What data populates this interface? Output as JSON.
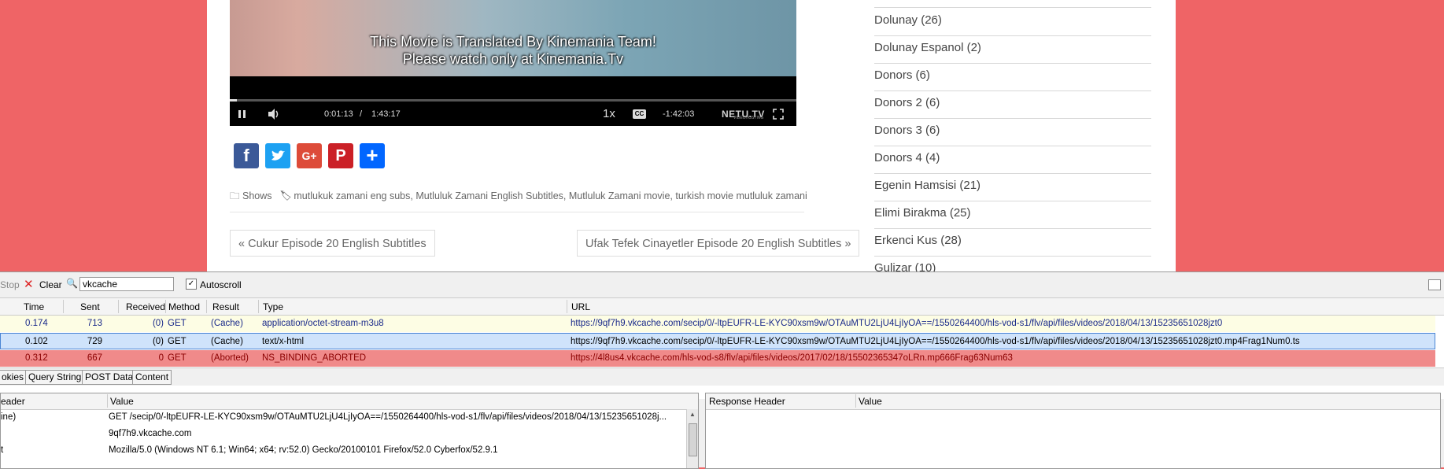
{
  "video": {
    "subtitle_line1": "This Movie is Translated By Kinemania Team!",
    "subtitle_line2": "Please watch only at Kinemania.Tv",
    "current_time": "0:01:13",
    "separator": "/",
    "duration": "1:43:17",
    "speed": "1x",
    "cc": "CC",
    "remaining": "-1:42:03",
    "logo": "NETU.TV",
    "logo_sub": "VIDEOHOSTING",
    "progress_fraction": 0.012
  },
  "share": {
    "facebook": "f",
    "google_plus": "G+",
    "pinterest": "P",
    "add": "+"
  },
  "meta": {
    "category": "Shows",
    "tags": [
      "mutlukuk zamani eng subs",
      "Mutluluk Zamani English Subtitles",
      "Mutluluk Zamani movie",
      "turkish movie mutluluk zamani"
    ]
  },
  "post_nav": {
    "prev": "« Cukur Episode 20 English Subtitles",
    "next": "Ufak Tefek Cinayetler Episode 20 English Subtitles »"
  },
  "categories": [
    "Dolunay (26)",
    "Dolunay Espanol (2)",
    "Donors (6)",
    "Donors 2 (6)",
    "Donors 3 (6)",
    "Donors 4 (4)",
    "Egenin Hamsisi (21)",
    "Elimi Birakma (25)",
    "Erkenci Kus (28)",
    "Gulizar (10)"
  ],
  "toolbar": {
    "stop": "Stop",
    "clear": "Clear",
    "filter_value": "vkcache",
    "autoscroll": "Autoscroll",
    "autoscroll_checked": "✓"
  },
  "requests": {
    "columns": [
      "Time",
      "Sent",
      "Received",
      "Method",
      "Result",
      "Type",
      "URL"
    ],
    "rows": [
      {
        "time": "0.174",
        "sent": "713",
        "received": "(0)",
        "method": "GET",
        "result": "(Cache)",
        "type": "application/octet-stream-m3u8",
        "url": "https://9qf7h9.vkcache.com/secip/0/-ltpEUFR-LE-KYC90xsm9w/OTAuMTU2LjU4LjIyOA==/1550264400/hls-vod-s1/flv/api/files/videos/2018/04/13/15235651028jzt0"
      },
      {
        "time": "0.102",
        "sent": "729",
        "received": "(0)",
        "method": "GET",
        "result": "(Cache)",
        "type": "text/x-html",
        "url": "https://9qf7h9.vkcache.com/secip/0/-ltpEUFR-LE-KYC90xsm9w/OTAuMTU2LjU4LjIyOA==/1550264400/hls-vod-s1/flv/api/files/videos/2018/04/13/15235651028jzt0.mp4Frag1Num0.ts"
      },
      {
        "time": "0.312",
        "sent": "667",
        "received": "0",
        "method": "GET",
        "result": "(Aborted)",
        "type": "NS_BINDING_ABORTED",
        "url": "https://4l8us4.vkcache.com/hls-vod-s8/flv/api/files/videos/2017/02/18/15502365347oLRn.mp666Frag63Num63"
      }
    ]
  },
  "detail_tabs": [
    "okies",
    "Query String",
    "POST Data",
    "Content"
  ],
  "request_headers": {
    "col_name": "eader",
    "col_value": "Value",
    "rows": [
      {
        "name": "ine)",
        "value": "GET /secip/0/-ltpEUFR-LE-KYC90xsm9w/OTAuMTU2LjU4LjIyOA==/1550264400/hls-vod-s1/flv/api/files/videos/2018/04/13/15235651028j..."
      },
      {
        "name": "",
        "value": "9qf7h9.vkcache.com"
      },
      {
        "name": "t",
        "value": "Mozilla/5.0 (Windows NT 6.1; Win64; x64; rv:52.0) Gecko/20100101 Firefox/52.0 Cyberfox/52.9.1"
      }
    ]
  },
  "response_headers": {
    "col_name": "Response Header",
    "col_value": "Value"
  },
  "colors": {
    "background": "#ef6466",
    "facebook": "#3b5998",
    "twitter": "#1da1f2",
    "google_plus": "#dd4b39",
    "pinterest": "#cb2027",
    "share_add": "#0166ff",
    "row_selected": "#cfe3fb",
    "row_aborted": "#f08a8a"
  }
}
